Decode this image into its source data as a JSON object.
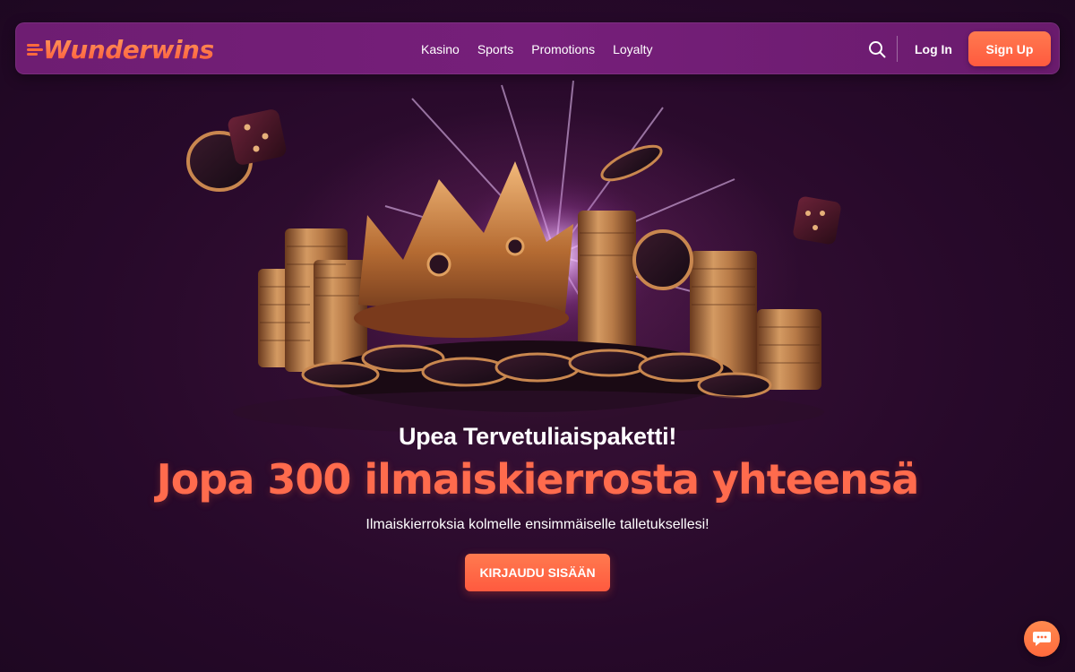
{
  "brand": {
    "logo_text": "Wunderwins"
  },
  "nav": {
    "items": [
      {
        "label": "Kasino"
      },
      {
        "label": "Sports"
      },
      {
        "label": "Promotions"
      },
      {
        "label": "Loyalty"
      }
    ]
  },
  "header": {
    "search_icon": "search-icon",
    "login_label": "Log In",
    "signup_label": "Sign Up"
  },
  "hero": {
    "title": "Upea Tervetuliaispaketti!",
    "headline": "Jopa 300 ilmaiskierrosta yhteensä",
    "subtitle": "Ilmaiskierroksia kolmelle ensimmäiselle talletuksellesi!",
    "cta_label": "KIRJAUDU SISÄÄN"
  },
  "chat": {
    "icon": "chat-bubble-icon"
  },
  "colors": {
    "accent": "#ff6b4d",
    "header_bg": "#731e77",
    "page_bg": "#27092a"
  }
}
